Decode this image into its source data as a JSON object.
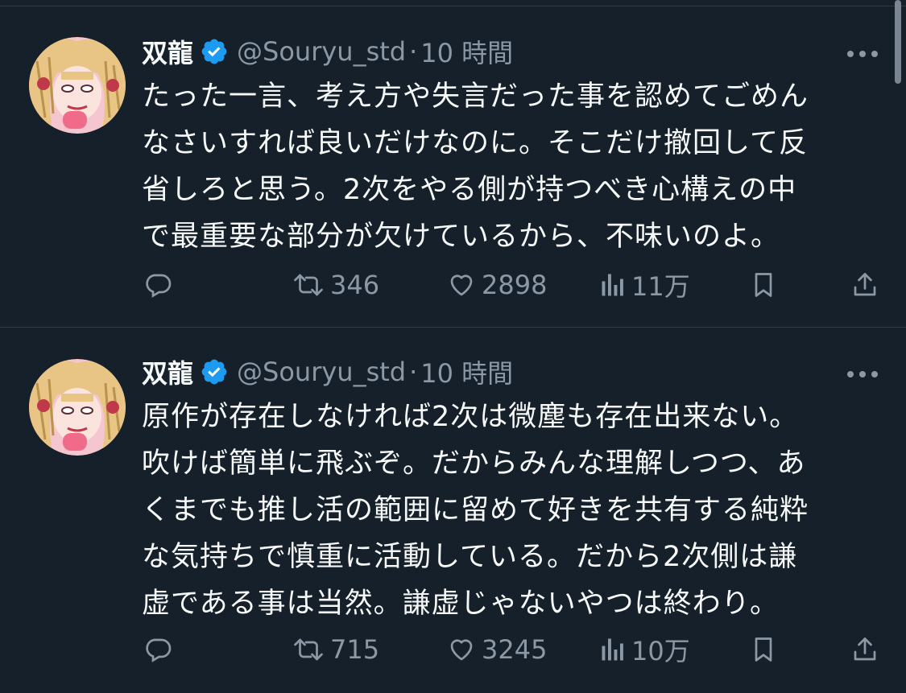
{
  "colors": {
    "background": "#15202b",
    "text": "#f7f9f9",
    "secondary": "#8b98a5",
    "verified": "#1d9bf0",
    "divider": "#2f3b47"
  },
  "tweets": [
    {
      "name": "双龍",
      "handle": "@Souryu_std",
      "separator": "·",
      "time": "10 時間",
      "text": "たった一言、考え方や失言だった事を認めてごめん\nなさいすれば良いだけなのに。そこだけ撤回して反\n省しろと思う。2次をやる側が持つべき心構えの中\nで最重要な部分が欠けているから、不味いのよ。",
      "retweets": "346",
      "likes": "2898",
      "views": "11万",
      "icons": [
        "reply-icon",
        "retweet-icon",
        "like-icon",
        "views-icon",
        "bookmark-icon",
        "share-icon"
      ]
    },
    {
      "name": "双龍",
      "handle": "@Souryu_std",
      "separator": "·",
      "time": "10 時間",
      "text": "原作が存在しなければ2次は微塵も存在出来ない。\n吹けば簡単に飛ぶぞ。だからみんな理解しつつ、あ\nくまでも推し活の範囲に留めて好きを共有する純粋\nな気持ちで慎重に活動している。だから2次側は謙\n虚である事は当然。謙虚じゃないやつは終わり。",
      "retweets": "715",
      "likes": "3245",
      "views": "10万",
      "icons": [
        "reply-icon",
        "retweet-icon",
        "like-icon",
        "views-icon",
        "bookmark-icon",
        "share-icon"
      ]
    }
  ]
}
